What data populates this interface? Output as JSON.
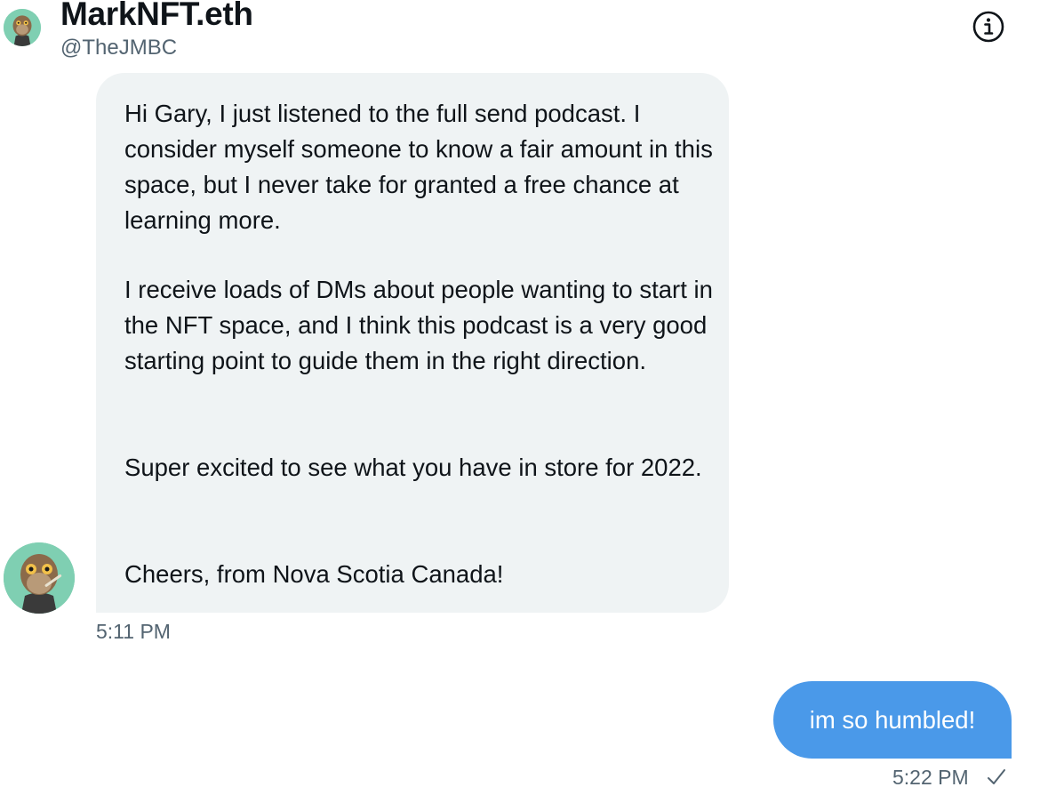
{
  "header": {
    "name": "MarkNFT.eth",
    "handle": "@TheJMBC",
    "info_icon": "info-icon"
  },
  "received_message": {
    "paragraphs": [
      "Hi Gary, I just listened to the full send podcast. I consider myself someone to know a fair amount in this space, but I never take for granted a free chance at learning more.",
      "I receive loads of DMs about people wanting to start in the NFT space, and I think this podcast is a very good starting point to guide them in the right direction.",
      "Super excited to see what you have in store for 2022.",
      "Cheers, from Nova Scotia Canada!"
    ],
    "time": "5:11 PM",
    "bubble_color": "#eff3f4"
  },
  "sent_message": {
    "text": "im so humbled!",
    "time": "5:22 PM",
    "status_icon": "check-icon",
    "bubble_color": "#4a99e9"
  },
  "colors": {
    "text_primary": "#0f1419",
    "text_secondary": "#536471",
    "avatar_bg": "#7fcfb2"
  }
}
